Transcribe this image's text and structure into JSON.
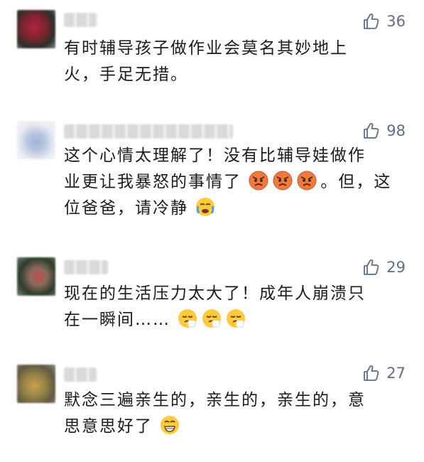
{
  "colors": {
    "like_icon": "#5b6e8a",
    "like_count": "#5f6e86",
    "text": "#1b1b1b"
  },
  "comments": [
    {
      "likes": "36",
      "lines": [
        "有时辅导孩子做作业会莫名其妙地上",
        "火，手足无措。"
      ]
    },
    {
      "likes": "98",
      "lines": [
        "这个心情太理解了！没有比辅导娃做作",
        "业更让我暴怒的事情了",
        "。但，这",
        "位爸爸，请冷静"
      ],
      "emoji_names": [
        "angry-face-icon",
        "angry-face-icon",
        "angry-face-icon",
        "crying-face-icon"
      ]
    },
    {
      "likes": "29",
      "lines": [
        "现在的生活压力太大了！成年人崩溃只",
        "在一瞬间……"
      ],
      "emoji_names": [
        "sneezing-face-icon",
        "sneezing-face-icon",
        "sneezing-face-icon"
      ]
    },
    {
      "likes": "27",
      "lines": [
        "默念三遍亲生的，亲生的，亲生的，意",
        "思意思好了"
      ],
      "emoji_names": [
        "grinning-face-icon"
      ]
    }
  ]
}
